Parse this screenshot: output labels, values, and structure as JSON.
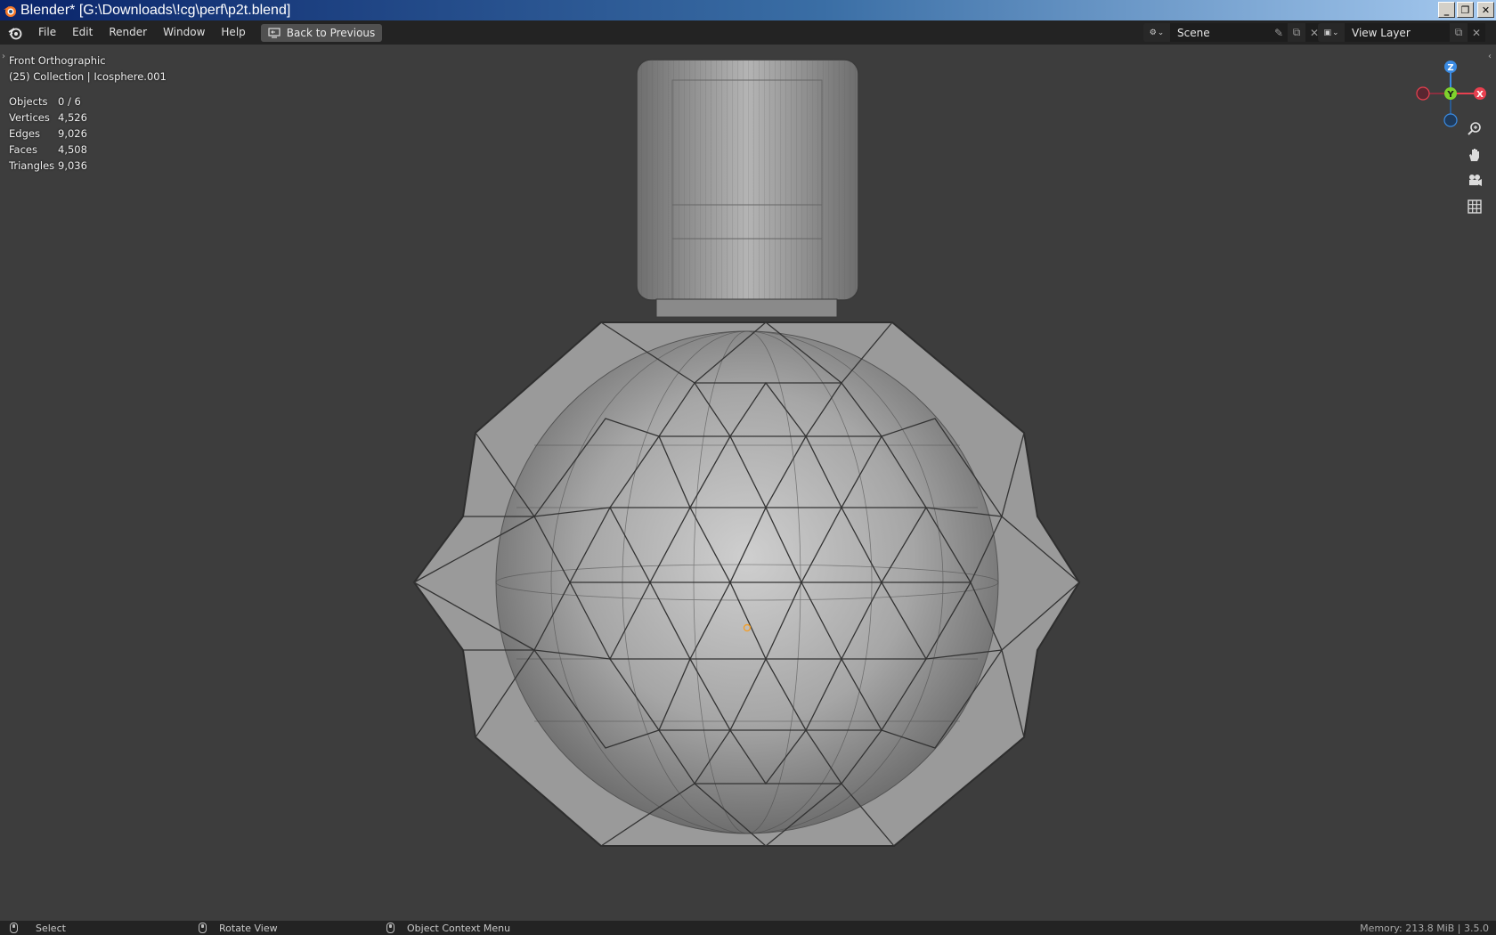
{
  "window": {
    "title": "Blender* [G:\\Downloads\\!cg\\perf\\p2t.blend]",
    "controls": {
      "minimize": "_",
      "restore": "❐",
      "close": "✕"
    }
  },
  "menubar": {
    "items": [
      "File",
      "Edit",
      "Render",
      "Window",
      "Help"
    ],
    "back_button": "Back to Previous",
    "scene": {
      "label": "Scene"
    },
    "view_layer": {
      "label": "View Layer"
    }
  },
  "viewport": {
    "view_name": "Front Orthographic",
    "collection_info": "(25) Collection | Icosphere.001",
    "stats": [
      {
        "label": "Objects",
        "value": "0 / 6"
      },
      {
        "label": "Vertices",
        "value": "4,526"
      },
      {
        "label": "Edges",
        "value": "9,026"
      },
      {
        "label": "Faces",
        "value": "4,508"
      },
      {
        "label": "Triangles",
        "value": "9,036"
      }
    ],
    "gizmo_axes": {
      "z": "Z",
      "y": "Y",
      "x": "X"
    },
    "nav_tools": [
      "zoom-icon",
      "pan-hand-icon",
      "camera-icon",
      "grid-icon"
    ]
  },
  "statusbar": {
    "select": "Select",
    "rotate": "Rotate View",
    "context_menu": "Object Context Menu",
    "memory": "Memory: 213.8 MiB | 3.5.0"
  },
  "colors": {
    "axis_x": "#e8404f",
    "axis_y": "#7fd12c",
    "axis_z": "#3a8be3",
    "viewport_bg": "#3d3d3d",
    "origin": "#f0a030"
  }
}
